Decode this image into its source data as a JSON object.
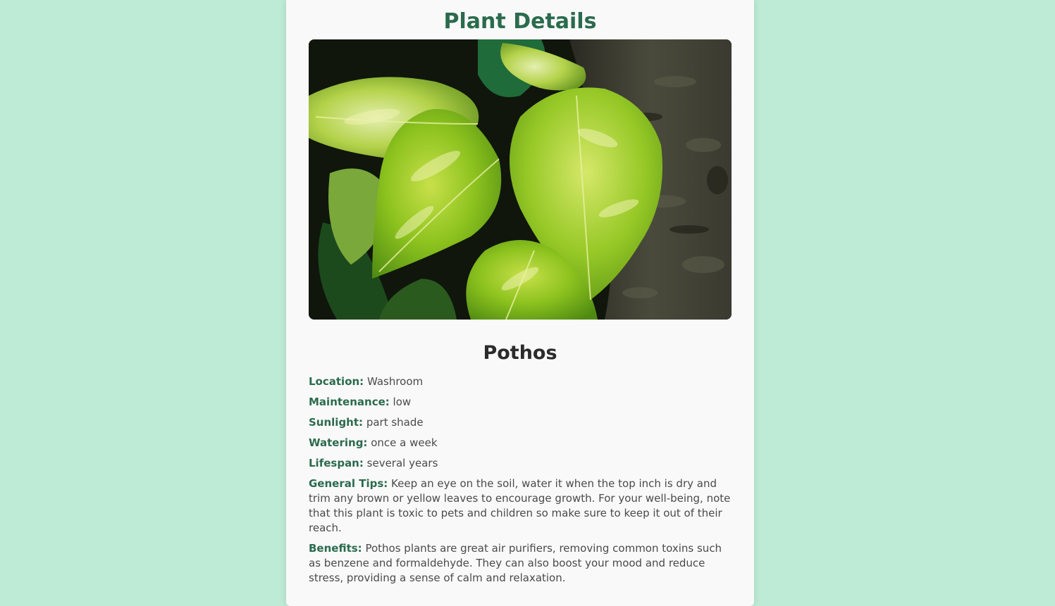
{
  "page": {
    "title": "Plant Details"
  },
  "plant": {
    "name": "Pothos",
    "image_alt": "pothos-leaves-photo",
    "details": [
      {
        "label": "Location:",
        "value": "Washroom"
      },
      {
        "label": "Maintenance:",
        "value": "low"
      },
      {
        "label": "Sunlight:",
        "value": "part shade"
      },
      {
        "label": "Watering:",
        "value": "once a week"
      },
      {
        "label": "Lifespan:",
        "value": "several years"
      },
      {
        "label": "General Tips:",
        "value": "Keep an eye on the soil, water it when the top inch is dry and trim any brown or yellow leaves to encourage growth. For your well-being, note that this plant is toxic to pets and children so make sure to keep it out of their reach."
      },
      {
        "label": "Benefits:",
        "value": "Pothos plants are great air purifiers, removing common toxins such as benzene and formaldehyde. They can also boost your mood and reduce stress, providing a sense of calm and relaxation."
      }
    ]
  },
  "colors": {
    "background": "#bdebd6",
    "card": "#f9f9f9",
    "accent": "#2b6b4d",
    "text": "#4a4a4a"
  }
}
